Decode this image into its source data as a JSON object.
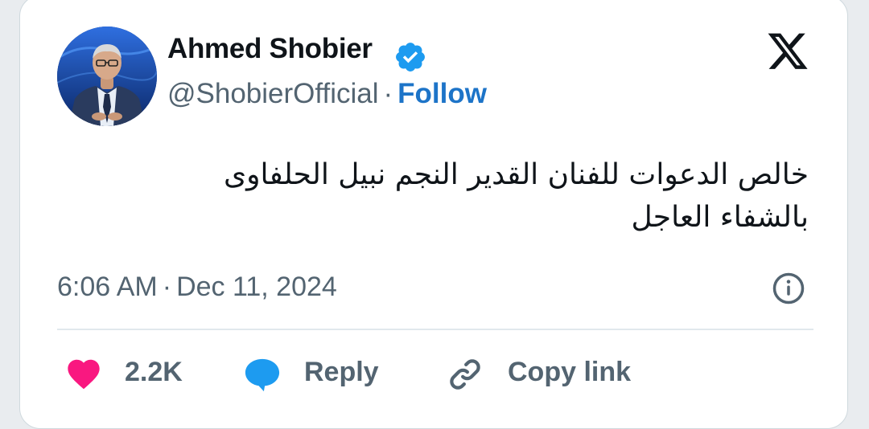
{
  "tweet": {
    "author_name": "Ahmed Shobier",
    "handle": "@ShobierOfficial",
    "separator": "·",
    "follow_label": "Follow",
    "text_line1": "خالص الدعوات للفنان القدير النجم نبيل الحلفاوى",
    "text_line2": "بالشفاء العاجل",
    "time": "6:06 AM",
    "date": "Dec 11, 2024",
    "likes": "2.2K",
    "reply_label": "Reply",
    "copy_link_label": "Copy link"
  },
  "colors": {
    "verified": "#1d9bf0",
    "follow": "#1d74c8",
    "like_heart": "#f91880",
    "reply_bubble": "#1d9bf0",
    "text_primary": "#0f1419",
    "text_secondary": "#536471"
  },
  "icons": {
    "verified": "verified-badge-icon",
    "platform": "x-logo-icon",
    "info": "info-icon",
    "like": "heart-icon",
    "reply": "reply-bubble-icon",
    "copy": "link-icon"
  }
}
